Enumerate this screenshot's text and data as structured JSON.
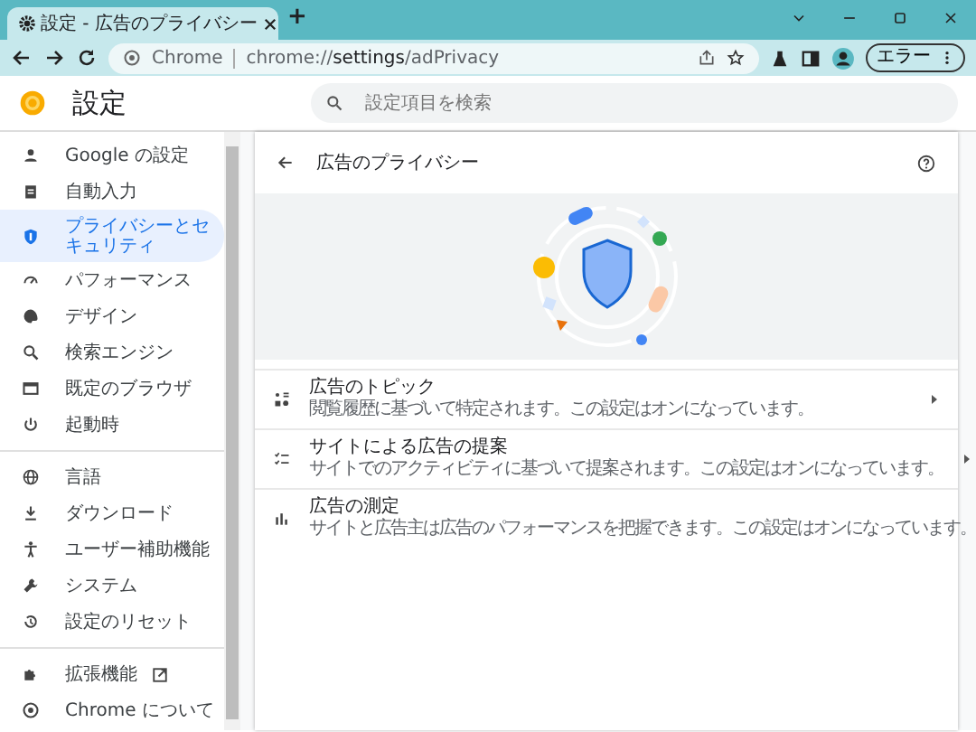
{
  "browser": {
    "tabs": [
      {
        "title": "設定 - 広告のプライバシー",
        "selected": true
      }
    ],
    "new_tab": "+",
    "address": {
      "site_label": "Chrome",
      "url_prefix": "chrome://",
      "url_bold": "settings",
      "url_rest": "/adPrivacy"
    },
    "profile_button": "エラー"
  },
  "header": {
    "title": "設定",
    "search": {
      "placeholder": "設定項目を検索"
    }
  },
  "sidebar": {
    "groups": [
      {
        "items": [
          {
            "label": "Google の設定",
            "selected": false
          },
          {
            "label": "自動入力",
            "selected": false
          },
          {
            "label": "プライバシーとセキュリティ",
            "selected": true
          },
          {
            "label": "パフォーマンス",
            "selected": false
          },
          {
            "label": "デザイン",
            "selected": false
          },
          {
            "label": "検索エンジン",
            "selected": false
          },
          {
            "label": "既定のブラウザ",
            "selected": false
          },
          {
            "label": "起動時",
            "selected": false
          }
        ]
      },
      {
        "items": [
          {
            "label": "言語",
            "selected": false
          },
          {
            "label": "ダウンロード",
            "selected": false
          },
          {
            "label": "ユーザー補助機能",
            "selected": false
          },
          {
            "label": "システム",
            "selected": false
          },
          {
            "label": "設定のリセット",
            "selected": false
          }
        ]
      },
      {
        "items": [
          {
            "label": "拡張機能",
            "selected": false,
            "external": true
          },
          {
            "label": "Chrome について",
            "selected": false,
            "external": false
          }
        ]
      }
    ]
  },
  "page": {
    "title": "広告のプライバシー",
    "rows": [
      {
        "title": "広告のトピック",
        "description": "閲覧履歴に基づいて特定されます。この設定はオンになっています。"
      },
      {
        "title": "サイトによる広告の提案",
        "description": "サイトでのアクティビティに基づいて提案されます。この設定はオンになっています。"
      },
      {
        "title": "広告の測定",
        "description": "サイトと広告主は広告のパフォーマンスを把握できます。この設定はオンになっています。"
      }
    ]
  }
}
